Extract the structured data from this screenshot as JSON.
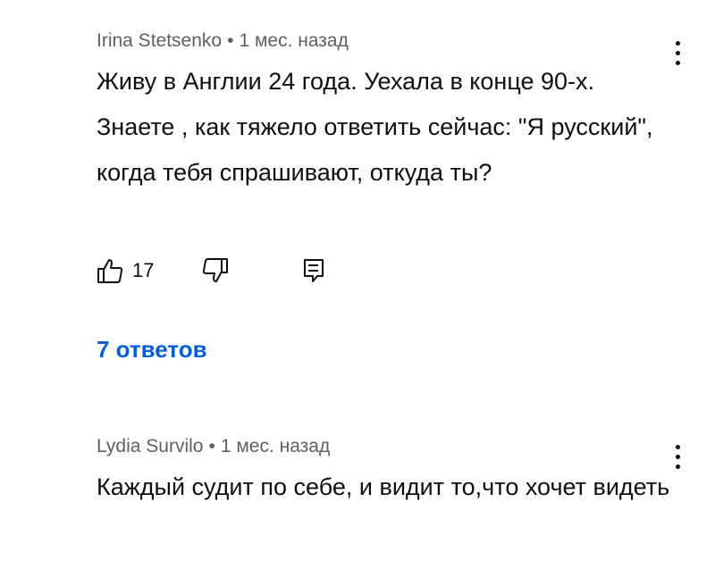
{
  "comments": [
    {
      "author": "Irina Stetsenko",
      "separator": "•",
      "time": "1 мес. назад",
      "text": "Живу в Англии 24 года. Уехала в конце 90-х. Знаете , как тяжело ответить сейчас: \"Я русский\", когда тебя спрашивают, откуда ты?",
      "likes": "17",
      "replies_label": "7 ответов"
    },
    {
      "author": "Lydia Survilo",
      "separator": "•",
      "time": "1 мес. назад",
      "text": "Каждый судит по себе, и видит то,что хочет видеть"
    }
  ],
  "icons": {
    "like": "thumb-up-icon",
    "dislike": "thumb-down-icon",
    "reply": "comment-reply-icon",
    "more": "more-vertical-icon"
  },
  "colors": {
    "link": "#065fd4",
    "meta": "#606060",
    "text": "#0f0f0f"
  }
}
